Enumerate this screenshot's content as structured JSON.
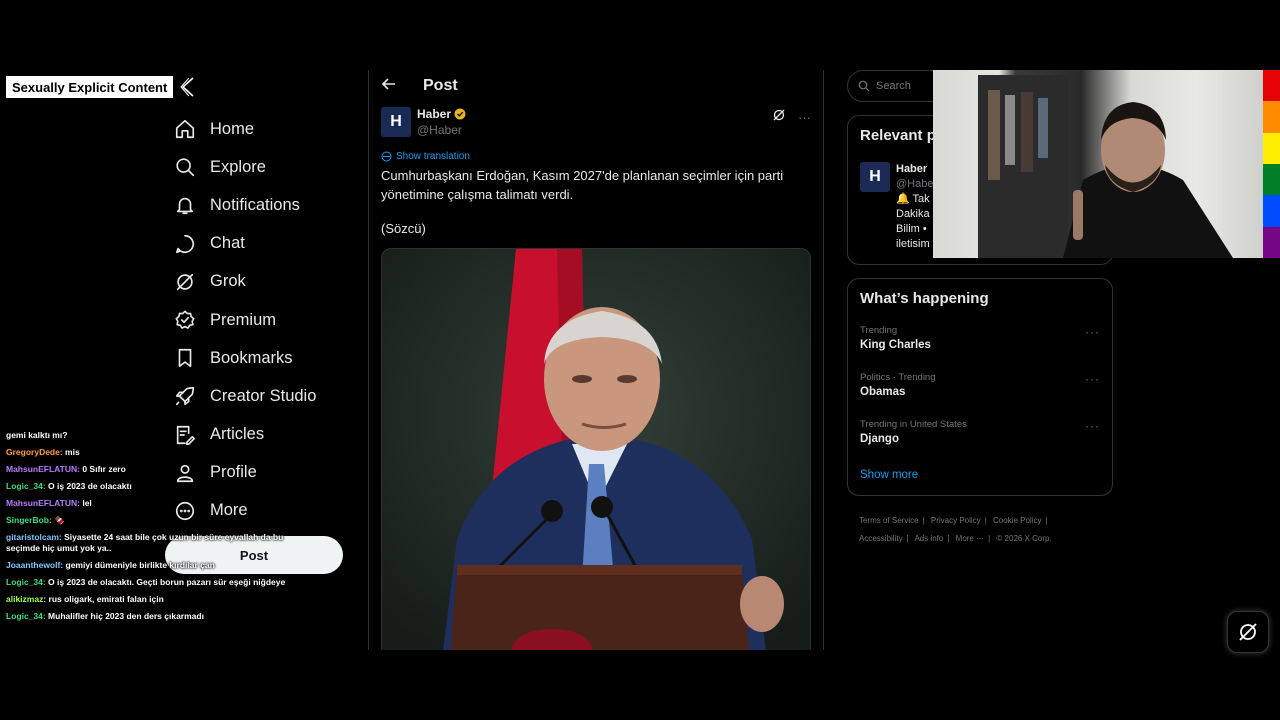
{
  "overlay": {
    "badge": "Sexually Explicit Content"
  },
  "nav": {
    "items": [
      {
        "label": "Home",
        "icon": "home-icon"
      },
      {
        "label": "Explore",
        "icon": "search-icon"
      },
      {
        "label": "Notifications",
        "icon": "bell-icon"
      },
      {
        "label": "Chat",
        "icon": "chat-icon"
      },
      {
        "label": "Grok",
        "icon": "grok-icon"
      },
      {
        "label": "Premium",
        "icon": "premium-icon"
      },
      {
        "label": "Bookmarks",
        "icon": "bookmark-icon"
      },
      {
        "label": "Creator Studio",
        "icon": "rocket-icon"
      },
      {
        "label": "Articles",
        "icon": "articles-icon"
      },
      {
        "label": "Profile",
        "icon": "person-icon"
      },
      {
        "label": "More",
        "icon": "more-icon"
      }
    ],
    "post_button": "Post"
  },
  "chat": {
    "messages": [
      {
        "user": "",
        "user_color": "#ffffff",
        "text": "gemi kalktı mı?"
      },
      {
        "user": "GregoryDede:",
        "user_color": "#ff9f40",
        "text": "mis"
      },
      {
        "user": "MahsunEFLATUN:",
        "user_color": "#b57cff",
        "text": "0 Sıfır zero"
      },
      {
        "user": "Logic_34:",
        "user_color": "#3ddc84",
        "text": "O iş 2023 de olacaktı"
      },
      {
        "user": "MahsunEFLATUN:",
        "user_color": "#b57cff",
        "text": "lel"
      },
      {
        "user": "SingerBob:",
        "user_color": "#3ddc84",
        "text": "🍫"
      },
      {
        "user": "gitaristolcam:",
        "user_color": "#7ec8ff",
        "text": "Siyasette 24 saat bile çok uzun bir süre eyvallah da bu seçimde hiç umut yok ya.."
      },
      {
        "user": "Joaanthewolf:",
        "user_color": "#7ec8ff",
        "text": "gemiyi dümeniyle birlikte kırdılar çan"
      },
      {
        "user": "Logic_34:",
        "user_color": "#3ddc84",
        "text": "O iş 2023 de olacaktı. Geçti borun pazarı sür eşeği niğdeye"
      },
      {
        "user": "alikizmaz:",
        "user_color": "#9cff57",
        "text": "rus oligark, emirati falan için"
      },
      {
        "user": "Logic_34:",
        "user_color": "#3ddc84",
        "text": "Muhalifler hiç 2023 den ders çıkarmadı"
      }
    ]
  },
  "main": {
    "header_title": "Post",
    "author": {
      "name": "Haber",
      "handle": "@Haber",
      "avatar_letter": "H",
      "verified_color": "#e6b422"
    },
    "show_translation": "Show translation",
    "text": "Cumhurbaşkanı Erdoğan, Kasım 2027'de planlanan seçimler için parti yönetimine çalışma talimatı verdi.",
    "source": "(Sözcü)",
    "more_label": "···"
  },
  "right": {
    "search_placeholder": "Search",
    "relevant": {
      "title": "Relevant p",
      "name": "Haber",
      "handle": "@Habe",
      "bio_lines": [
        "🔔 Tak",
        "Dakika",
        "Bilim • ",
        "iletisim"
      ]
    },
    "happening": {
      "title": "What’s happening",
      "trends": [
        {
          "category": "Trending",
          "name": "King Charles"
        },
        {
          "category": "Politics · Trending",
          "name": "Obamas"
        },
        {
          "category": "Trending in United States",
          "name": "Django"
        }
      ],
      "show_more": "Show more"
    },
    "footer": {
      "links": [
        "Terms of Service",
        "Privacy Policy",
        "Cookie Policy",
        "Accessibility",
        "Ads info",
        "More ···",
        "© 2026 X Corp."
      ]
    }
  },
  "colors": {
    "accent": "#1d9bf0",
    "background": "#000000",
    "border": "#2f3336",
    "rainbow": [
      "#e40303",
      "#ff8c00",
      "#ffed00",
      "#008026",
      "#004dff",
      "#750787"
    ]
  }
}
